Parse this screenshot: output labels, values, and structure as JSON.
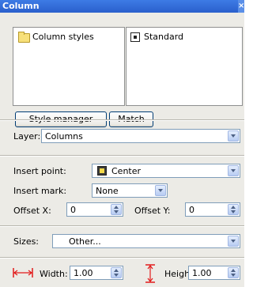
{
  "window": {
    "title": "Column",
    "close_glyph": "×"
  },
  "styles_list": {
    "item": "Column styles",
    "icon": "folder-icon"
  },
  "style_preview": {
    "item": "Standard",
    "icon": "standard-style-icon"
  },
  "buttons": {
    "style_manager": "Style manager",
    "match": "Match"
  },
  "layer": {
    "label": "Layer:",
    "value": "Columns"
  },
  "insert_point": {
    "label": "Insert point:",
    "value": "Center",
    "icon": "center-point-icon"
  },
  "insert_mark": {
    "label": "Insert mark:",
    "value": "None"
  },
  "offset_x": {
    "label": "Offset X:",
    "value": "0"
  },
  "offset_y": {
    "label": "Offset Y:",
    "value": "0"
  },
  "sizes": {
    "label": "Sizes:",
    "value": "Other..."
  },
  "width": {
    "label": "Width:",
    "value": "1.00",
    "icon": "width-arrow-icon"
  },
  "height": {
    "label": "Heigh",
    "value": "1.00",
    "icon": "height-arrow-icon"
  },
  "colors": {
    "title_bar": "#2a5fcc",
    "panel": "#ecebe6",
    "dimension_icon": "#e21b1b"
  }
}
